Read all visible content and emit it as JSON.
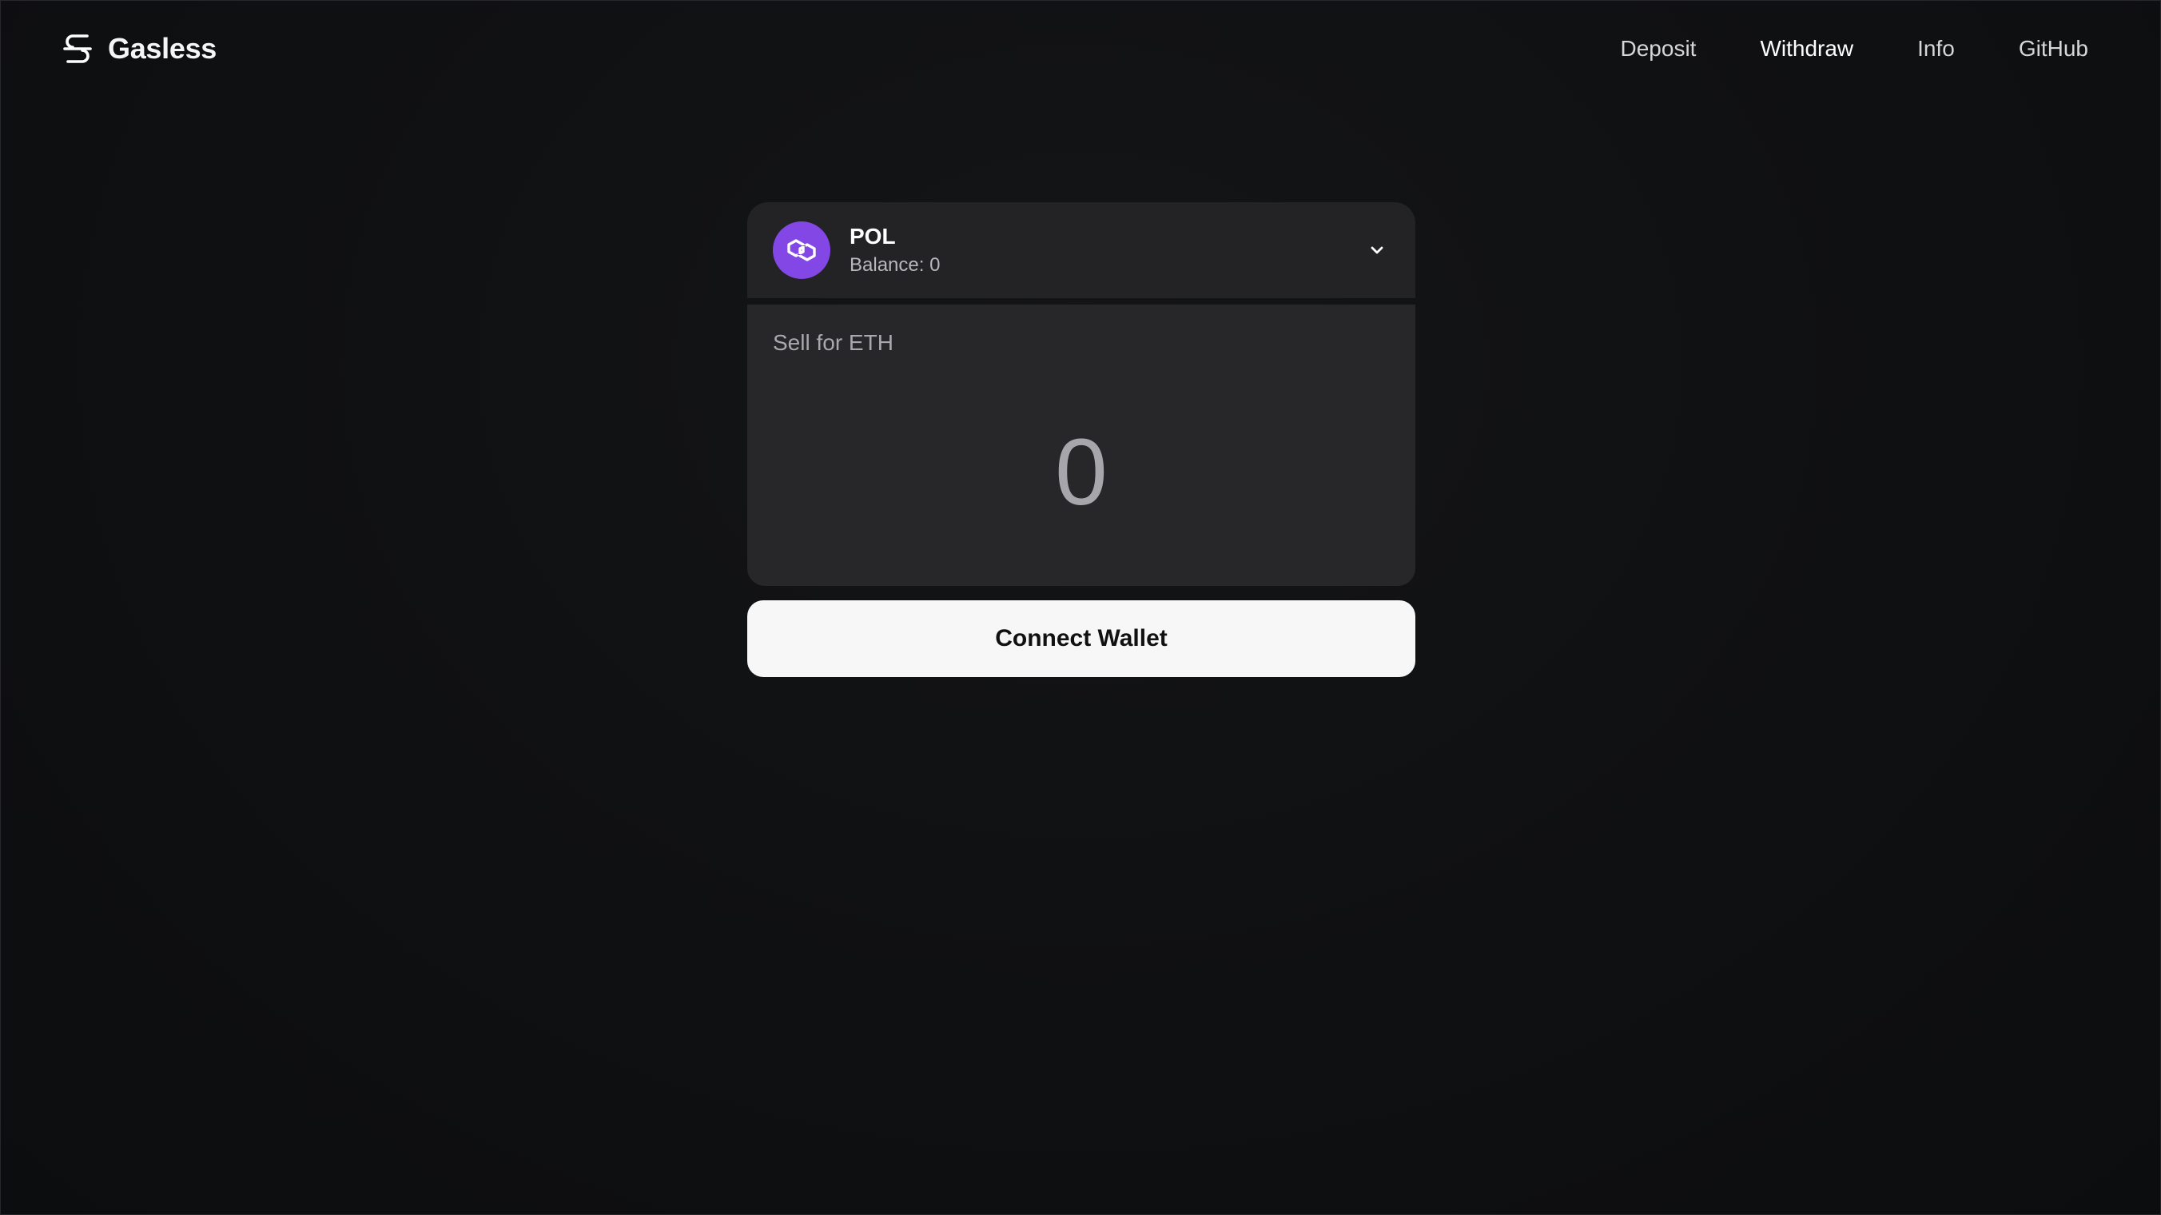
{
  "header": {
    "brand_name": "Gasless",
    "brand_icon": "gasless-logo-icon",
    "nav": [
      {
        "label": "Deposit",
        "active": false
      },
      {
        "label": "Withdraw",
        "active": true
      },
      {
        "label": "Info",
        "active": false
      },
      {
        "label": "GitHub",
        "active": false
      }
    ]
  },
  "swap": {
    "token": {
      "symbol": "POL",
      "balance_text": "Balance: 0",
      "icon": "polygon-token-icon",
      "icon_color": "#8247e5"
    },
    "sell_label": "Sell for ETH",
    "amount_placeholder": "0",
    "amount_value": "",
    "connect_label": "Connect Wallet"
  },
  "colors": {
    "background": "#0f1012",
    "card": "#232326",
    "button": "#f7f7f7"
  }
}
